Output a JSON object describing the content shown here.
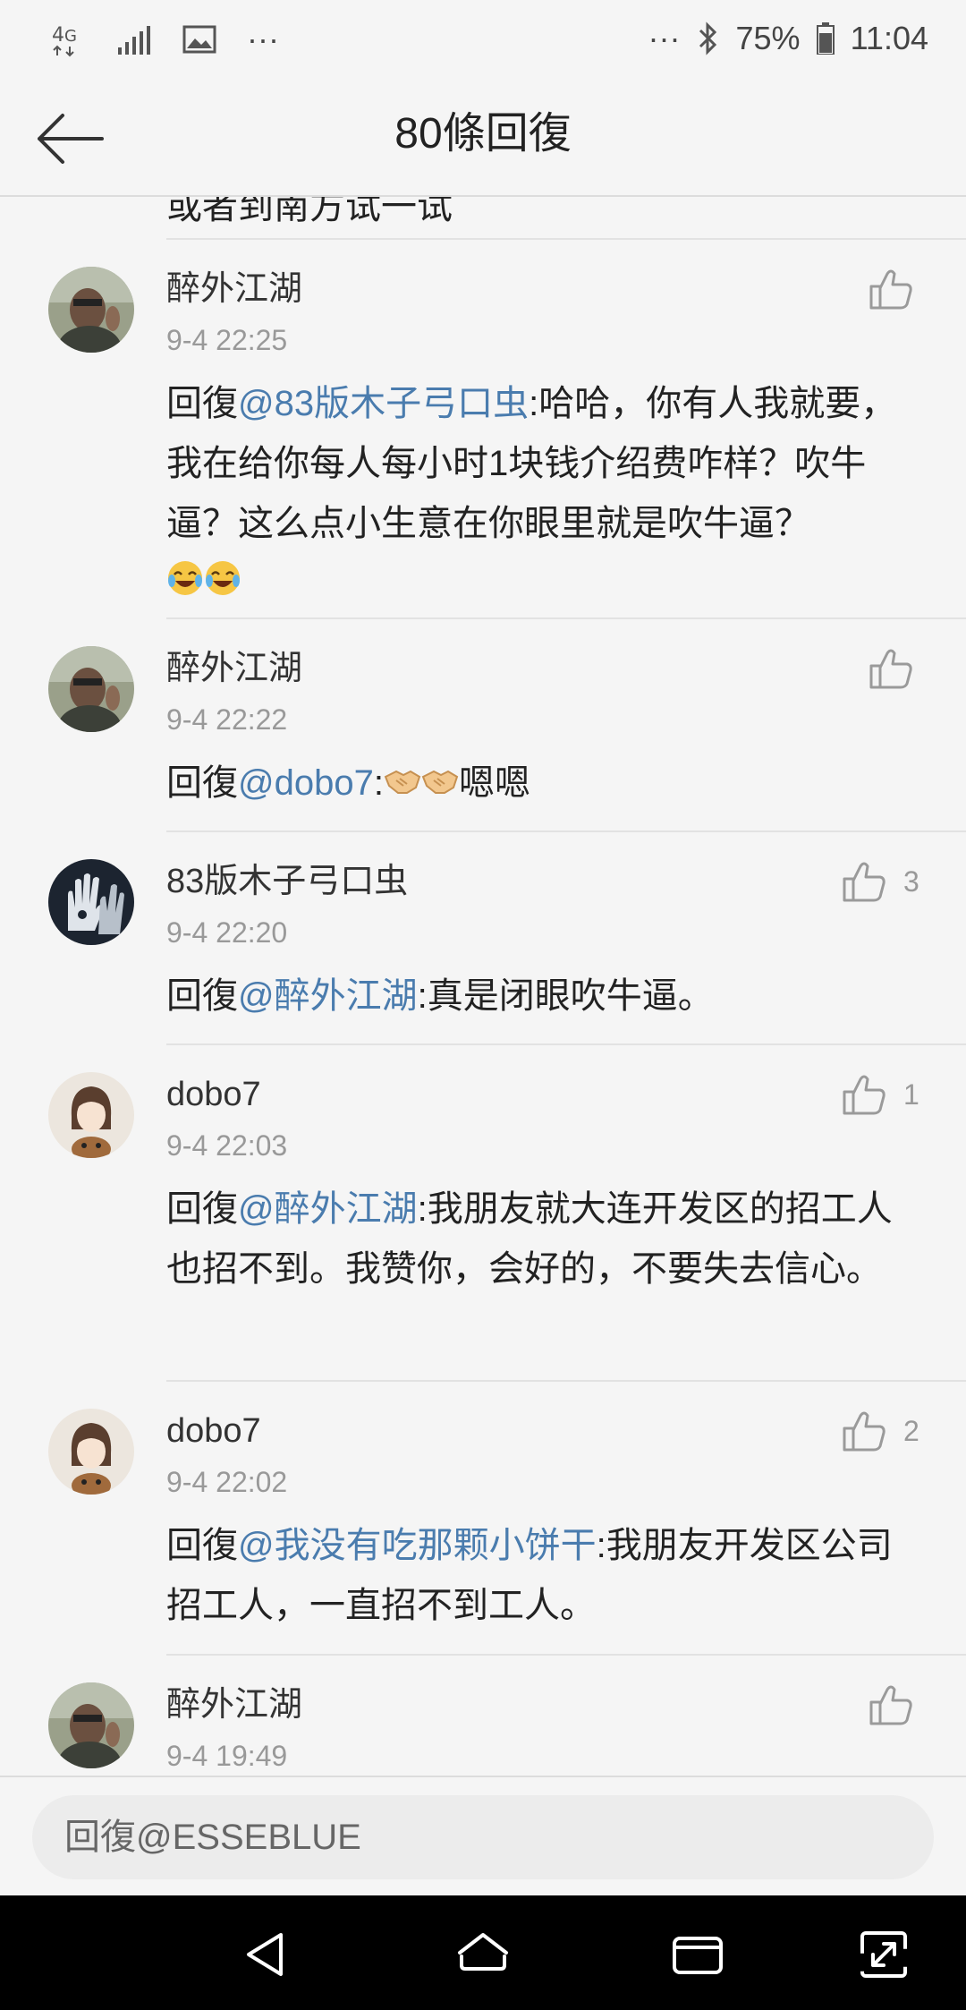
{
  "status_bar": {
    "network": "4G",
    "more": "···",
    "battery_percent": "75%",
    "time": "11:04"
  },
  "header": {
    "title": "80條回復"
  },
  "partial_text": "或者到南方试一试",
  "comments": [
    {
      "name": "醉外江湖",
      "time": "9-4 22:25",
      "reply_prefix": "回復",
      "mention": "@83版木子弓口虫",
      "text": ":哈哈，你有人我就要，我在给你每人每小时1块钱介绍费咋样？吹牛逼？这么点小生意在你眼里就是吹牛逼？",
      "emoji": [
        "laughing-crying",
        "laughing-crying"
      ],
      "likes": ""
    },
    {
      "name": "醉外江湖",
      "time": "9-4 22:22",
      "reply_prefix": "回復",
      "mention": "@dobo7",
      "text_before": ":",
      "emoji": [
        "handshake",
        "handshake"
      ],
      "text": "嗯嗯",
      "likes": ""
    },
    {
      "name": "83版木子弓口虫",
      "time": "9-4 22:20",
      "reply_prefix": "回復",
      "mention": "@醉外江湖",
      "text": ":真是闭眼吹牛逼。",
      "likes": "3"
    },
    {
      "name": "dobo7",
      "time": "9-4 22:03",
      "reply_prefix": "回復",
      "mention": "@醉外江湖",
      "text": ":我朋友就大连开发区的招工人也招不到。我赞你，会好的，不要失去信心。",
      "likes": "1"
    },
    {
      "name": "dobo7",
      "time": "9-4 22:02",
      "reply_prefix": "回復",
      "mention": "@我没有吃那颗小饼干",
      "text": ":我朋友开发区公司招工人，一直招不到工人。",
      "likes": "2"
    },
    {
      "name": "醉外江湖",
      "time": "9-4 19:49",
      "likes": ""
    }
  ],
  "reply_input": {
    "placeholder": "回復@ESSEBLUE"
  },
  "nav": {
    "back": "back-icon",
    "home": "home-icon",
    "recents": "recents-icon",
    "rotate": "rotate-icon"
  }
}
